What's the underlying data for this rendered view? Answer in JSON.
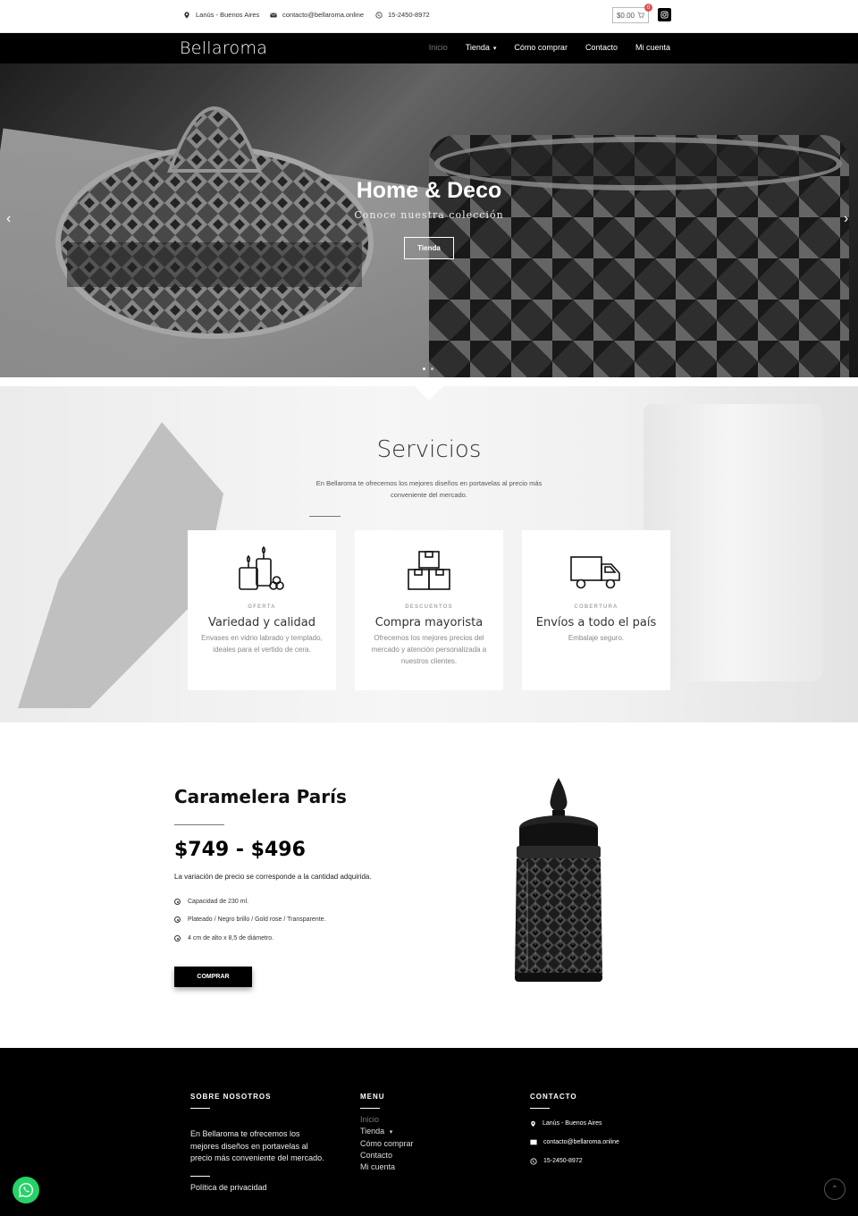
{
  "topbar": {
    "location": "Lanús - Buenos Aires",
    "email": "contacto@bellaroma.online",
    "phone": "15-2450-8972",
    "cart_total": "$0.00",
    "cart_count": "0"
  },
  "brand": {
    "name": "Bellaroma"
  },
  "nav": {
    "items": [
      {
        "label": "Inicio"
      },
      {
        "label": "Tienda"
      },
      {
        "label": "Cómo comprar"
      },
      {
        "label": "Contacto"
      },
      {
        "label": "Mi cuenta"
      }
    ]
  },
  "hero": {
    "title": "Home & Deco",
    "subtitle": "Conoce nuestra colección",
    "button": "Tienda",
    "slides": 2,
    "active_slide": 1
  },
  "services": {
    "title": "Servicios",
    "intro": "En Bellaroma te ofrecemos los mejores diseños en portavelas al precio más conveniente del mercado.",
    "cards": [
      {
        "icon": "candles-icon",
        "tag": "OFERTA",
        "title": "Variedad y calidad",
        "desc": "Envases en vidrio labrado y templado, ideales para el vertido de cera."
      },
      {
        "icon": "boxes-icon",
        "tag": "DESCUENTOS",
        "title": "Compra mayorista",
        "desc": "Ofrecemos los mejores precios del mercado y atención personalizada a nuestros clientes."
      },
      {
        "icon": "truck-icon",
        "tag": "COBERTURA",
        "title": "Envíos a todo el país",
        "desc": "Embalaje seguro."
      }
    ]
  },
  "product": {
    "name": "Caramelera París",
    "price": "$749 - $496",
    "note": "La variación de precio se corresponde a la cantidad adquirida.",
    "features": [
      "Capacidad de 230 ml.",
      "Plateado / Negro brillo / Gold rose / Transparente.",
      "4 cm de alto x 8,5 de diámetro."
    ],
    "button": "COMPRAR"
  },
  "footer": {
    "about": {
      "heading": "SOBRE NOSOTROS",
      "text": "En Bellaroma te ofrecemos los mejores diseños en portavelas al precio más conveniente del mercado.",
      "privacy": "Política de privacidad"
    },
    "menu": {
      "heading": "MENU",
      "items": [
        "Inicio",
        "Tienda",
        "Cómo comprar",
        "Contacto",
        "Mi cuenta"
      ]
    },
    "contact": {
      "heading": "CONTACTO",
      "location": "Lanús - Buenos Aires",
      "email": "contacto@bellaroma.online",
      "phone": "15-2450-8972"
    }
  },
  "colors": {
    "whatsapp": "#25d366",
    "dark": "#000000",
    "cart_badge": "#d9534f"
  }
}
